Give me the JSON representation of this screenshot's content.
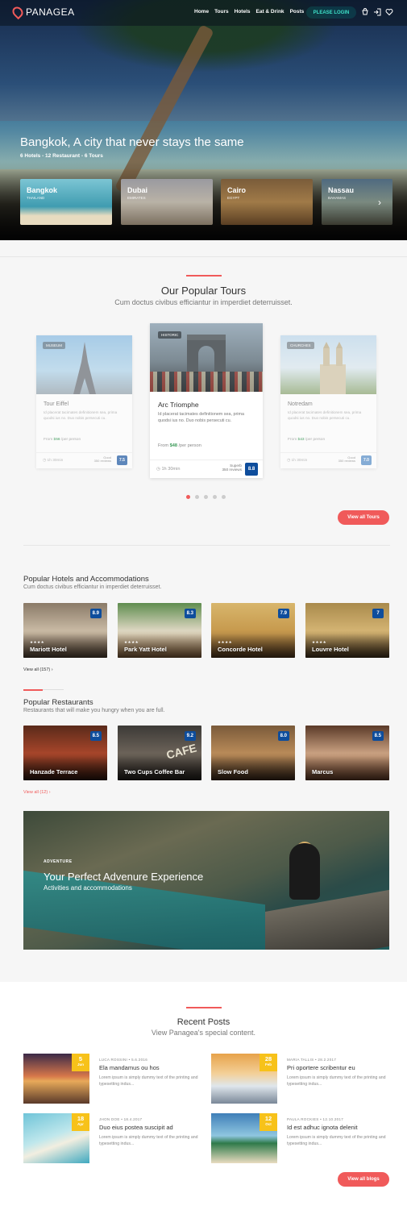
{
  "header": {
    "brand": "PANAGEA",
    "nav": [
      "Home",
      "Tours",
      "Hotels",
      "Eat & Drink",
      "Posts"
    ],
    "login": "PLEASE LOGIN"
  },
  "hero": {
    "title": "Bangkok, A city that never stays the same",
    "subtitle": "6 Hotels - 12 Restaurant - 6 Tours",
    "cities": [
      {
        "name": "Bangkok",
        "sub": "THAILAND"
      },
      {
        "name": "Dubai",
        "sub": "EMIRATES"
      },
      {
        "name": "Cairo",
        "sub": "EGYPT"
      },
      {
        "name": "Nassau",
        "sub": "BAHAMAS"
      }
    ]
  },
  "tours": {
    "title": "Our Popular Tours",
    "subtitle": "Cum doctus civibus efficiantur in imperdiet deterruisset.",
    "items": [
      {
        "tag": "MUSEUM",
        "name": "Tour Eiffel",
        "desc": "Id placerat tacimates definitionem sea, prima quodsi ius no. Duo nobis persecuti cu.",
        "price_prefix": "From ",
        "price": "$56",
        "price_suffix": " /per person",
        "duration": "1h 30min",
        "guide_top": "Good",
        "guide_bottom": "350 reviews",
        "score": "7.5"
      },
      {
        "tag": "HISTORIC",
        "name": "Arc Triomphe",
        "desc": "Id placerat tacimates definitionem sea, prima quodsi ius no. Duo nobis persecuti cu.",
        "price_prefix": "From ",
        "price": "$48",
        "price_suffix": " /per person",
        "duration": "1h 30min",
        "guide_top": "Superb",
        "guide_bottom": "350 reviews",
        "score": "8.8"
      },
      {
        "tag": "CHURCHES",
        "name": "Notredam",
        "desc": "Id placerat tacimates definitionem sea, prima quodsi ius no. Duo nobis persecuti cu.",
        "price_prefix": "From ",
        "price": "$43",
        "price_suffix": " /per person",
        "duration": "1h 30min",
        "guide_top": "Good",
        "guide_bottom": "350 reviews",
        "score": "7.0"
      }
    ],
    "view_all": "View all Tours"
  },
  "hotels": {
    "title": "Popular Hotels and Accommodations",
    "subtitle": "Cum doctus civibus efficiantur in imperdiet deterruisset.",
    "items": [
      {
        "name": "Mariott Hotel",
        "stars": "★★★★",
        "rating": "8.9"
      },
      {
        "name": "Park Yatt Hotel",
        "stars": "★★★★",
        "rating": "8.3"
      },
      {
        "name": "Concorde Hotel",
        "stars": "★★★★",
        "rating": "7.9"
      },
      {
        "name": "Louvre Hotel",
        "stars": "★★★★",
        "rating": "7"
      }
    ],
    "view_all": "View all (157)"
  },
  "restaurants": {
    "title": "Popular Restaurants",
    "subtitle": "Restaurants that will make you hungry when you are full.",
    "items": [
      {
        "name": "Hanzade Terrace",
        "rating": "8.5"
      },
      {
        "name": "Two Cups Coffee Bar",
        "rating": "9.2"
      },
      {
        "name": "Slow Food",
        "rating": "8.0"
      },
      {
        "name": "Marcus",
        "rating": "8.5"
      }
    ],
    "view_all": "View all (12)"
  },
  "adventure": {
    "tag": "ADVENTURE",
    "title": "Your Perfect Advenure Experience",
    "subtitle": "Activities and accommodations"
  },
  "posts": {
    "title": "Recent Posts",
    "subtitle": "View Panagea's special content.",
    "items": [
      {
        "day": "5",
        "month": "Jun",
        "meta": "LUCA ROSSINI   •   5.6.2016",
        "title": "Ela mandamus ou hos",
        "excerpt": "Lorem ipsum is simply dummy text of the printing and typesetting indus..."
      },
      {
        "day": "28",
        "month": "Feb",
        "meta": "MARIA TALLIS   •   28.2.2017",
        "title": "Pri oportere scribentur eu",
        "excerpt": "Lorem ipsum is simply dummy text of the printing and typesetting indus..."
      },
      {
        "day": "18",
        "month": "Apr",
        "meta": "JHON DOE   •   18.4.2017",
        "title": "Duo eius postea suscipit ad",
        "excerpt": "Lorem ipsum is simply dummy text of the printing and typesetting indus..."
      },
      {
        "day": "12",
        "month": "Oct",
        "meta": "PAULA ROCKIES   •   12.10.2017",
        "title": "Id est adhuc ignota delenit",
        "excerpt": "Lorem ipsum is simply dummy text of the printing and typesetting indus..."
      }
    ],
    "view_all": "View all blogs"
  },
  "colors": {
    "accent": "#f05a5a",
    "score": "#0e4d9c",
    "date_badge": "#f7c21a",
    "price": "#3c9a59"
  }
}
